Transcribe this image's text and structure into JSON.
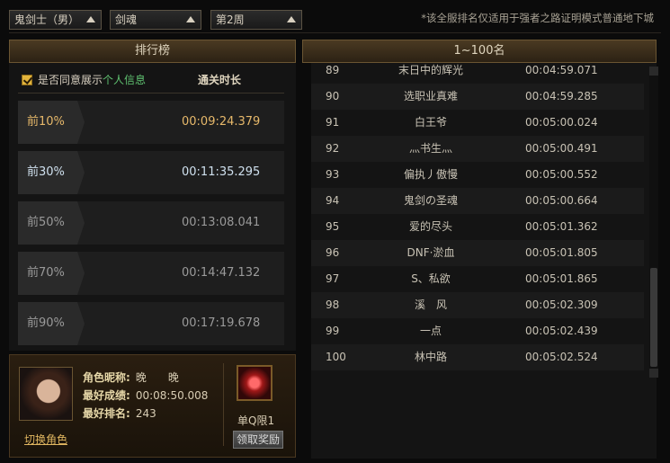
{
  "filters": {
    "class": "鬼剑士（男）",
    "subclass": "剑魂",
    "week": "第2周"
  },
  "notice": "*该全服排名仅适用于强者之路证明模式普通地下城",
  "left": {
    "title": "排行榜",
    "agree_prefix": "是否同意展示",
    "agree_link": "个人信息",
    "time_header": "通关时长",
    "tiers": [
      {
        "label": "前10%",
        "time": "00:09:24.379"
      },
      {
        "label": "前30%",
        "time": "00:11:35.295"
      },
      {
        "label": "前50%",
        "time": "00:13:08.041"
      },
      {
        "label": "前70%",
        "time": "00:14:47.132"
      },
      {
        "label": "前90%",
        "time": "00:17:19.678"
      }
    ],
    "tier_colors": [
      "#e6b86a",
      "#cfe0ee",
      "#9a9a9a",
      "#9a9a9a",
      "#9a9a9a"
    ]
  },
  "player": {
    "name_label": "角色昵称:",
    "name": "晚　　晚",
    "best_score_label": "最好成绩:",
    "best_score": "00:08:50.008",
    "best_rank_label": "最好排名:",
    "best_rank": "243",
    "switch_label": "切换角色",
    "reward_name": "单Q限1",
    "reward_button": "领取奖励"
  },
  "right": {
    "title": "1~100名",
    "rows": [
      {
        "rank": "89",
        "name": "末日中的辉光",
        "time": "00:04:59.071"
      },
      {
        "rank": "90",
        "name": "选职业真难",
        "time": "00:04:59.285"
      },
      {
        "rank": "91",
        "name": "白王爷",
        "time": "00:05:00.024"
      },
      {
        "rank": "92",
        "name": "灬书生灬",
        "time": "00:05:00.491"
      },
      {
        "rank": "93",
        "name": "偏执丿傲慢",
        "time": "00:05:00.552"
      },
      {
        "rank": "94",
        "name": "鬼剑の圣魂",
        "time": "00:05:00.664"
      },
      {
        "rank": "95",
        "name": "爱的尽头",
        "time": "00:05:01.362"
      },
      {
        "rank": "96",
        "name": "DNF·淤血",
        "time": "00:05:01.805"
      },
      {
        "rank": "97",
        "name": "S、私欲",
        "time": "00:05:01.865"
      },
      {
        "rank": "98",
        "name": "溪　风",
        "time": "00:05:02.309"
      },
      {
        "rank": "99",
        "name": "一点",
        "time": "00:05:02.439"
      },
      {
        "rank": "100",
        "name": "林中路",
        "time": "00:05:02.524"
      }
    ]
  }
}
